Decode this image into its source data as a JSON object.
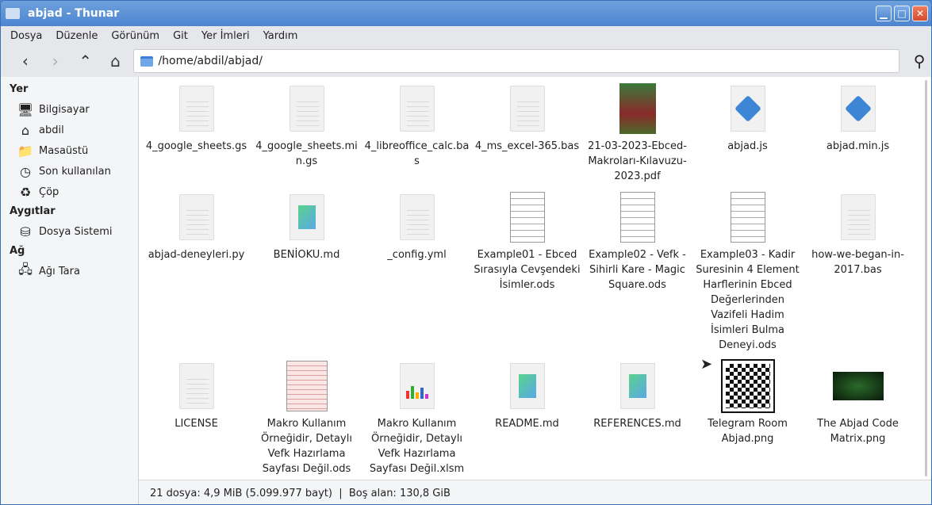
{
  "window": {
    "title": "abjad - Thunar"
  },
  "menu": [
    "Dosya",
    "Düzenle",
    "Görünüm",
    "Git",
    "Yer İmleri",
    "Yardım"
  ],
  "location": "/home/abdil/abjad/",
  "sidebar": {
    "sections": [
      {
        "title": "Yer",
        "items": [
          {
            "label": "Bilgisayar",
            "icon": "computer-icon"
          },
          {
            "label": "abdil",
            "icon": "home-icon"
          },
          {
            "label": "Masaüstü",
            "icon": "desktop-folder-icon"
          },
          {
            "label": "Son kullanılan",
            "icon": "clock-icon"
          },
          {
            "label": "Çöp",
            "icon": "trash-icon"
          }
        ]
      },
      {
        "title": "Aygıtlar",
        "items": [
          {
            "label": "Dosya Sistemi",
            "icon": "drive-icon"
          }
        ]
      },
      {
        "title": "Ağ",
        "items": [
          {
            "label": "Ağı Tara",
            "icon": "network-icon"
          }
        ]
      }
    ]
  },
  "files": [
    {
      "name": "4_google_sheets.gs",
      "type": "doc"
    },
    {
      "name": "4_google_sheets.min.gs",
      "type": "doc"
    },
    {
      "name": "4_libreoffice_calc.bas",
      "type": "doc"
    },
    {
      "name": "4_ms_excel-365.bas",
      "type": "doc"
    },
    {
      "name": "21-03-2023-Ebced-Makroları-Kılavuzu-2023.pdf",
      "type": "pdf"
    },
    {
      "name": "abjad.js",
      "type": "js"
    },
    {
      "name": "abjad.min.js",
      "type": "js"
    },
    {
      "name": "abjad-deneyleri.py",
      "type": "doc"
    },
    {
      "name": "BENİOKU.md",
      "type": "md"
    },
    {
      "name": "_config.yml",
      "type": "doc"
    },
    {
      "name": "Example01 - Ebced Sırasıyla Cevşendeki İsimler.ods",
      "type": "sheet"
    },
    {
      "name": "Example02 - Vefk - Sihirli Kare - Magic Square.ods",
      "type": "sheet"
    },
    {
      "name": "Example03 - Kadir Suresinin 4 Element Harflerinin Ebced Değerlerinden Vazifeli Hadim İsimleri Bulma Deneyi.ods",
      "type": "sheet"
    },
    {
      "name": "how-we-began-in-2017.bas",
      "type": "doc"
    },
    {
      "name": "LICENSE",
      "type": "doc"
    },
    {
      "name": "Makro Kullanım Örneğidir, Detaylı Vefk Hazırlama Sayfası Değil.ods",
      "type": "pink"
    },
    {
      "name": "Makro Kullanım Örneğidir, Detaylı Vefk Hazırlama Sayfası Değil.xlsm",
      "type": "xls"
    },
    {
      "name": "README.md",
      "type": "md"
    },
    {
      "name": "REFERENCES.md",
      "type": "md"
    },
    {
      "name": "Telegram Room Abjad.png",
      "type": "qr"
    },
    {
      "name": "The Abjad Code Matrix.png",
      "type": "matrix"
    }
  ],
  "status": "21 dosya: 4,9 MiB (5.099.977 bayt)  |  Boş alan: 130,8 GiB"
}
